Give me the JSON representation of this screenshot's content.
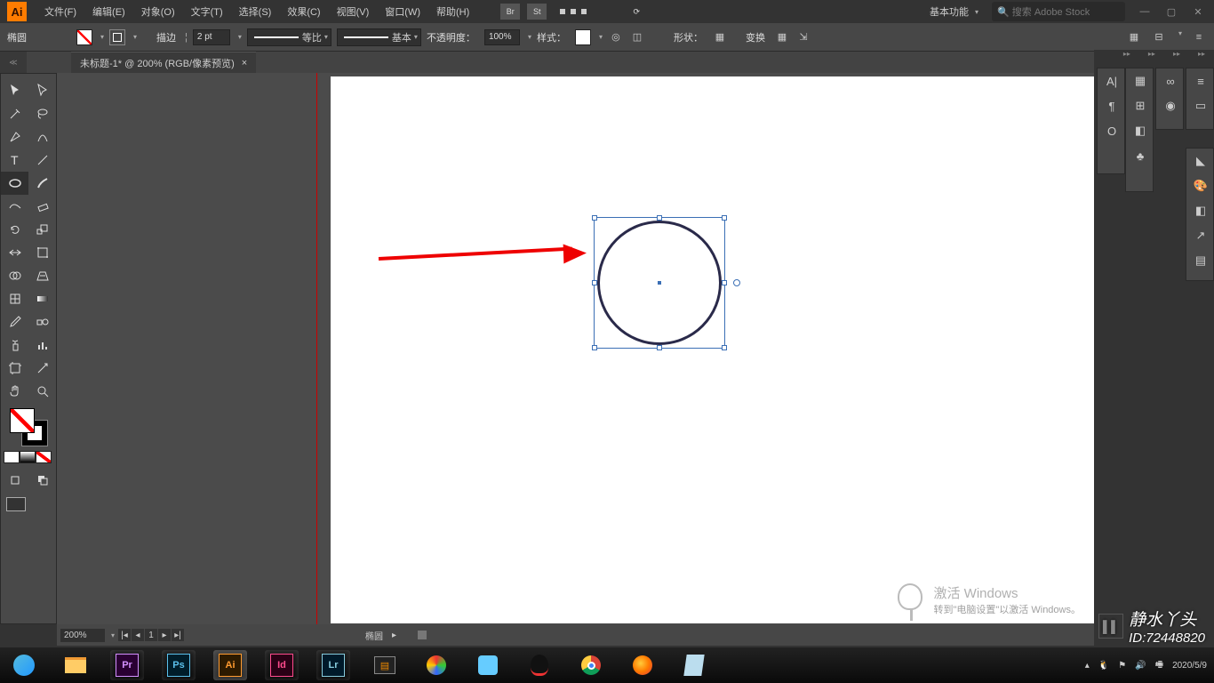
{
  "menubar": {
    "items": [
      "文件(F)",
      "编辑(E)",
      "对象(O)",
      "文字(T)",
      "选择(S)",
      "效果(C)",
      "视图(V)",
      "窗口(W)",
      "帮助(H)"
    ],
    "workspace": "基本功能",
    "search_placeholder": "搜索 Adobe Stock"
  },
  "controlbar": {
    "shape": "椭圆",
    "stroke_label": "描边",
    "stroke_pt": "2 pt",
    "profile": "等比",
    "brush": "基本",
    "opacity_label": "不透明度：",
    "opacity": "100%",
    "style_label": "样式：",
    "shape_label": "形状：",
    "transform_label": "变换"
  },
  "document": {
    "tab_title": "未标题-1* @ 200% (RGB/像素预览)"
  },
  "statusbar": {
    "zoom": "200%",
    "page": "1",
    "tool": "椭圆"
  },
  "activate": {
    "title": "激活 Windows",
    "sub": "转到\"电脑设置\"以激活 Windows。"
  },
  "watermark": {
    "name": "静水丫头",
    "id": "ID:72448820"
  },
  "taskbar": {
    "time": "2020/5/9"
  }
}
